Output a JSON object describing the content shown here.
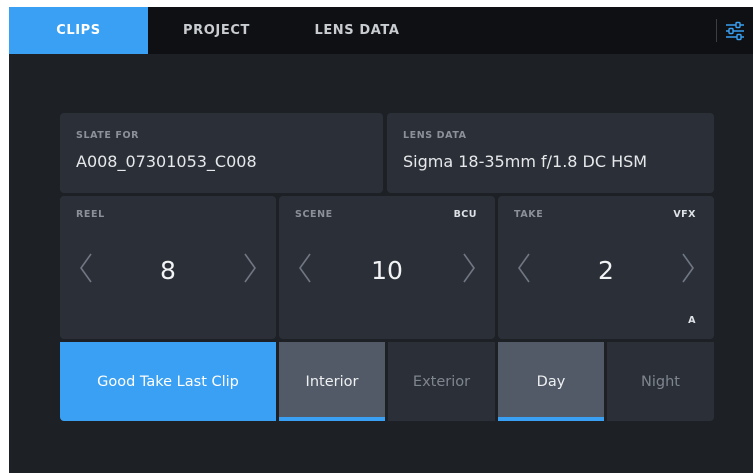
{
  "tabs": [
    {
      "label": "CLIPS",
      "active": true
    },
    {
      "label": "PROJECT",
      "active": false
    },
    {
      "label": "LENS DATA",
      "active": false
    }
  ],
  "menu_icon": "sliders-icon",
  "slate": {
    "label": "SLATE FOR",
    "value": "A008_07301053_C008"
  },
  "lens": {
    "label": "LENS DATA",
    "value": "Sigma 18-35mm f/1.8 DC HSM"
  },
  "reel": {
    "label": "REEL",
    "value": "8"
  },
  "scene": {
    "label": "SCENE",
    "value": "10",
    "badge": "BCU"
  },
  "take": {
    "label": "TAKE",
    "value": "2",
    "badge": "VFX",
    "sub_badge": "A"
  },
  "buttons": {
    "good_take": "Good Take Last Clip",
    "interior": "Interior",
    "exterior": "Exterior",
    "day": "Day",
    "night": "Night"
  },
  "toggles": {
    "interior_selected": true,
    "day_selected": true
  },
  "colors": {
    "accent": "#3aa0f3",
    "background": "#1d2025",
    "panel": "#2b3038",
    "selected": "#525a67"
  }
}
